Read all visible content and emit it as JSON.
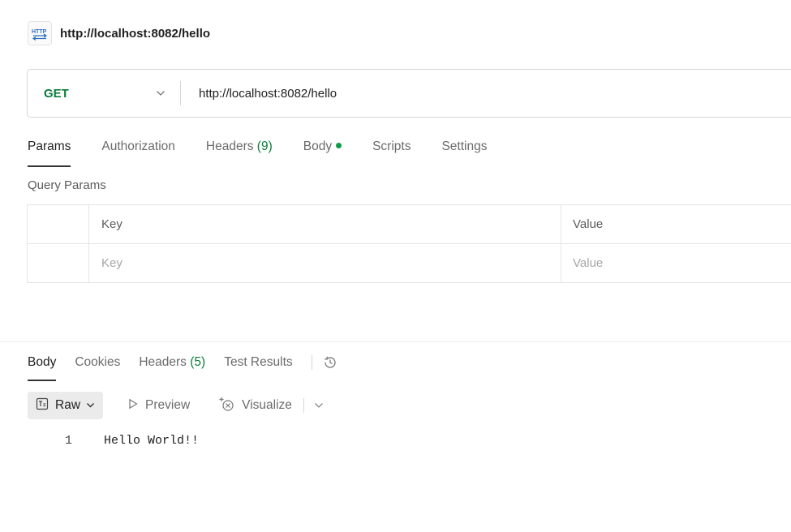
{
  "request": {
    "tab_title": "http://localhost:8082/hello",
    "method": "GET",
    "url": "http://localhost:8082/hello",
    "tabs": [
      {
        "label": "Params",
        "active": true
      },
      {
        "label": "Authorization"
      },
      {
        "label": "Headers",
        "count": "(9)"
      },
      {
        "label": "Body",
        "dot": true
      },
      {
        "label": "Scripts"
      },
      {
        "label": "Settings"
      }
    ],
    "query_params_label": "Query Params",
    "table": {
      "headers": [
        "Key",
        "Value"
      ],
      "placeholders": [
        "Key",
        "Value"
      ]
    }
  },
  "response": {
    "tabs": [
      {
        "label": "Body",
        "active": true
      },
      {
        "label": "Cookies"
      },
      {
        "label": "Headers",
        "count": "(5)"
      },
      {
        "label": "Test Results"
      }
    ],
    "view": {
      "raw": "Raw",
      "preview": "Preview",
      "visualize": "Visualize"
    },
    "lines": [
      {
        "number": "1",
        "text": "Hello World!!"
      }
    ]
  },
  "colors": {
    "method_green": "#0b7d3b",
    "status_dot": "#0b9b4a"
  },
  "icons": [
    "http-icon",
    "chevron-down-icon",
    "history-icon",
    "raw-format-icon",
    "play-icon",
    "sparkle-icon"
  ]
}
